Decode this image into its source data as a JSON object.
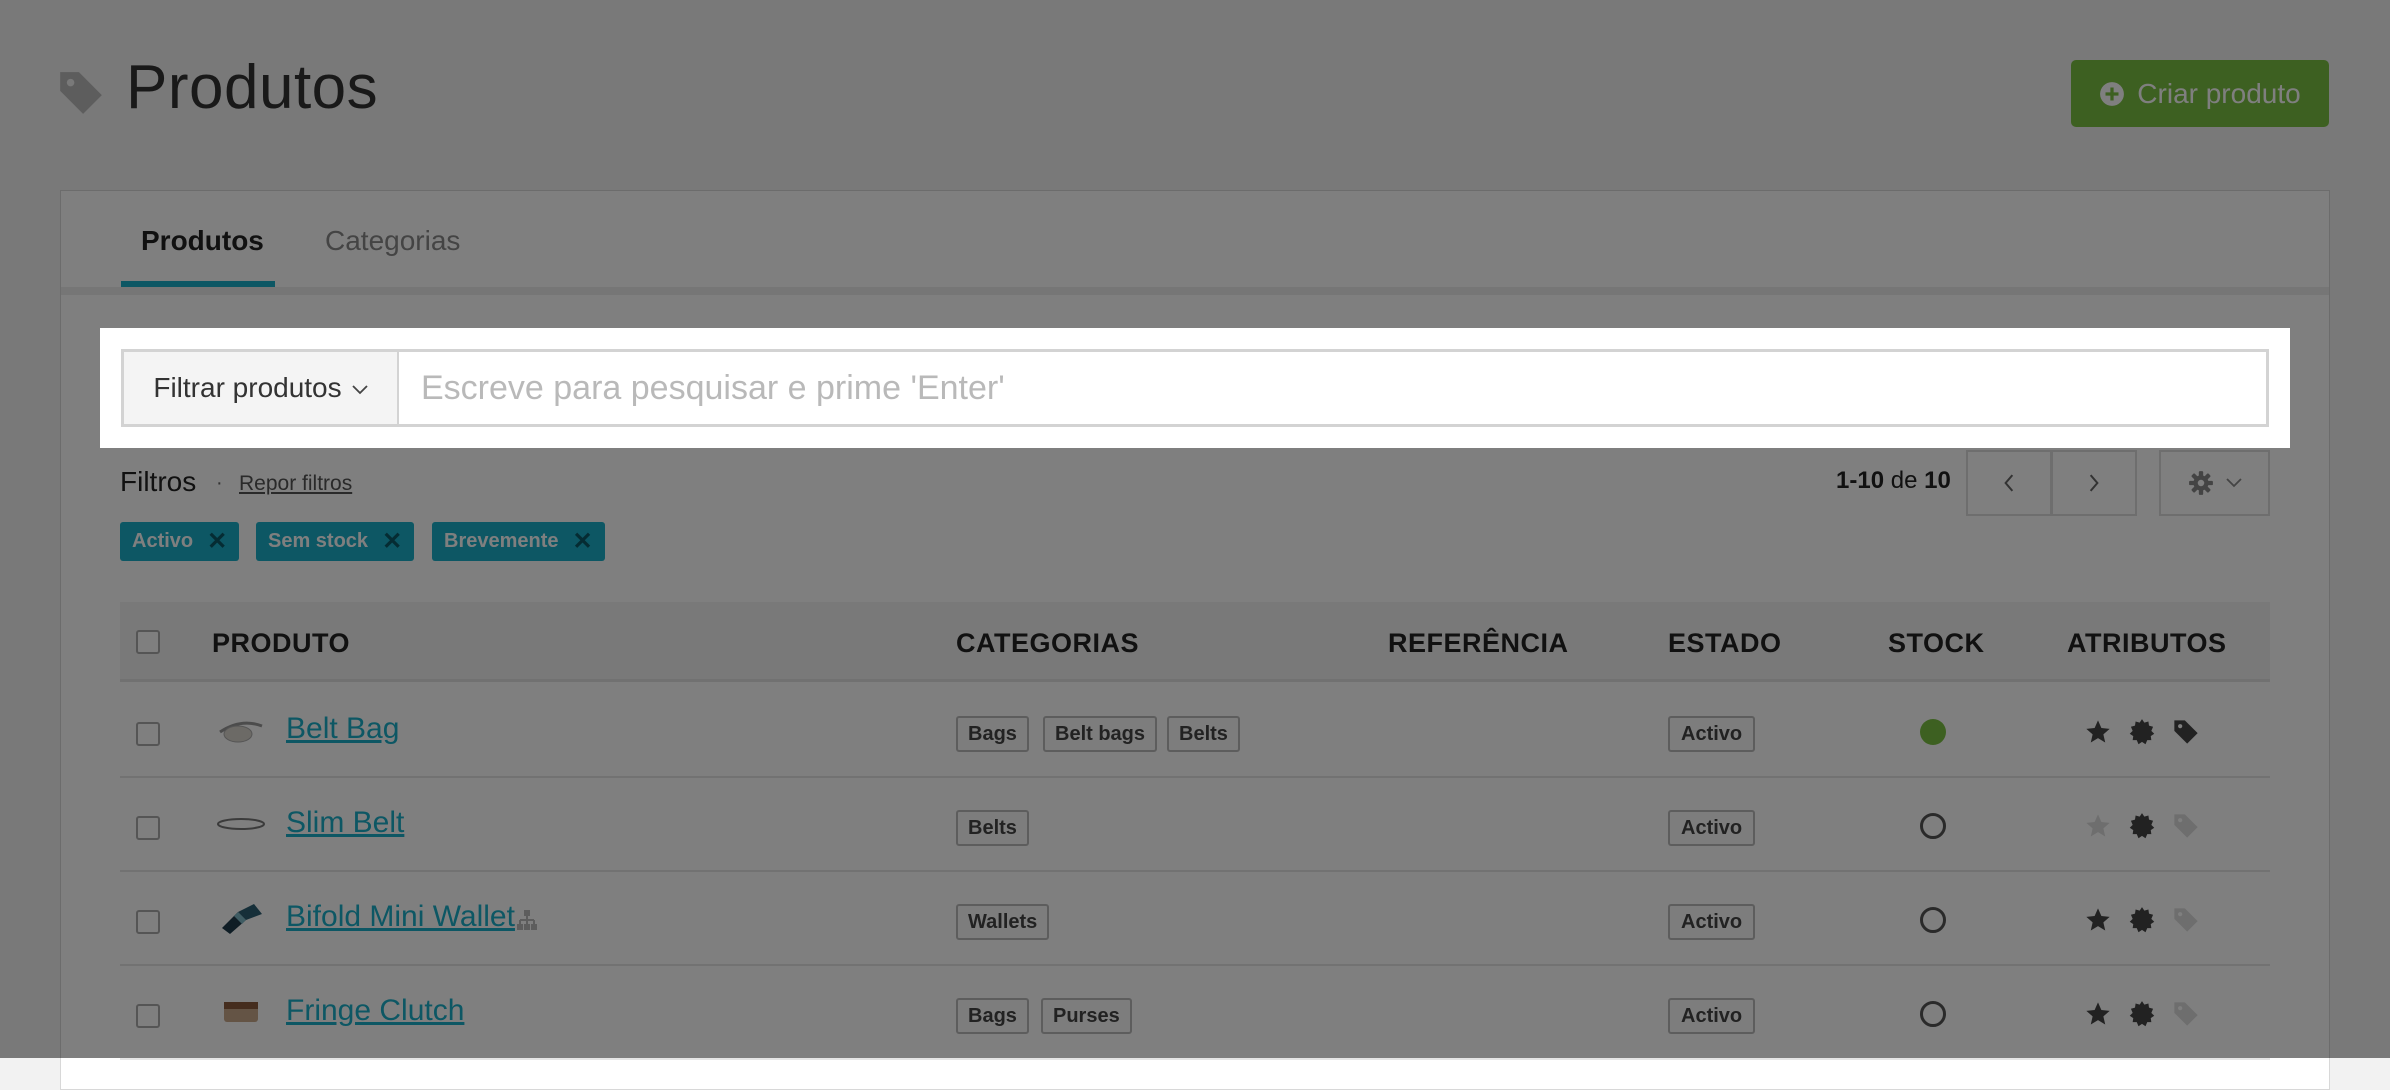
{
  "header": {
    "title": "Produtos",
    "title_icon": "tag-icon",
    "create_button": "Criar produto",
    "create_icon": "plus-circle-icon"
  },
  "tabs": [
    {
      "label": "Produtos",
      "active": true
    },
    {
      "label": "Categorias",
      "active": false
    }
  ],
  "search": {
    "filter_select": "Filtrar produtos",
    "placeholder": "Escreve para pesquisar e prime 'Enter'",
    "value": ""
  },
  "filters": {
    "label": "Filtros",
    "separator": "·",
    "reset": "Repor filtros",
    "chips": [
      "Activo",
      "Sem stock",
      "Brevemente"
    ],
    "chip_remove": "✕"
  },
  "pagination": {
    "range": "1-10",
    "of_word": "de",
    "total": "10"
  },
  "table": {
    "columns": [
      "PRODUTO",
      "CATEGORIAS",
      "REFERÊNCIA",
      "ESTADO",
      "STOCK",
      "ATRIBUTOS"
    ],
    "rows": [
      {
        "name": "Belt Bag",
        "categories": [
          "Bags",
          "Belt bags",
          "Belts"
        ],
        "reference": "",
        "status": "Activo",
        "stock": "in-stock",
        "has_variants": false,
        "attributes": {
          "featured": true,
          "badge": true,
          "promo": true
        }
      },
      {
        "name": "Slim Belt",
        "categories": [
          "Belts"
        ],
        "reference": "",
        "status": "Activo",
        "stock": "out-of-stock",
        "has_variants": false,
        "attributes": {
          "featured": false,
          "badge": true,
          "promo": false
        }
      },
      {
        "name": "Bifold Mini Wallet",
        "categories": [
          "Wallets"
        ],
        "reference": "",
        "status": "Activo",
        "stock": "out-of-stock",
        "has_variants": true,
        "attributes": {
          "featured": true,
          "badge": true,
          "promo": false
        }
      },
      {
        "name": "Fringe Clutch",
        "categories": [
          "Bags",
          "Purses"
        ],
        "reference": "",
        "status": "Activo",
        "stock": "out-of-stock",
        "has_variants": false,
        "attributes": {
          "featured": true,
          "badge": true,
          "promo": false
        }
      }
    ]
  },
  "colors": {
    "accent": "#1aafc8",
    "create_button": "#7ac143",
    "in_stock": "#7ac143",
    "attribute_on": "#444444",
    "attribute_off": "#dddddd"
  }
}
